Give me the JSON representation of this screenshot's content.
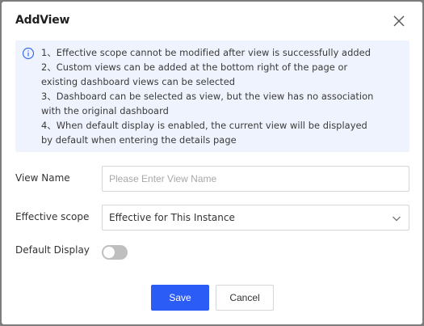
{
  "dialog": {
    "title": "AddView",
    "info_lines": [
      "1、Effective scope cannot be modified after view is successfully added",
      "2、Custom views can be added at the bottom right of the page or",
      "existing dashboard views can be selected",
      "3、Dashboard can be selected as view, but the view has no association",
      "with the original dashboard",
      "4、When default display is enabled, the current view will be displayed",
      "by default when entering the details page"
    ],
    "view_name": {
      "label": "View Name",
      "value": "",
      "placeholder": "Please Enter View Name"
    },
    "effective_scope": {
      "label": "Effective scope",
      "value": "Effective for This Instance"
    },
    "default_display": {
      "label": "Default Display",
      "enabled": false
    },
    "buttons": {
      "save": "Save",
      "cancel": "Cancel"
    }
  },
  "icons": {
    "close": "close-icon",
    "info": "info-circle-icon",
    "select_arrow": "chevron-down-icon"
  },
  "colors": {
    "primary": "#2b5cf6",
    "info_background": "#eef3fd",
    "info_icon": "#3a6df0",
    "toggle_off": "#bfbfbf",
    "backdrop": "#7d7d7d"
  }
}
